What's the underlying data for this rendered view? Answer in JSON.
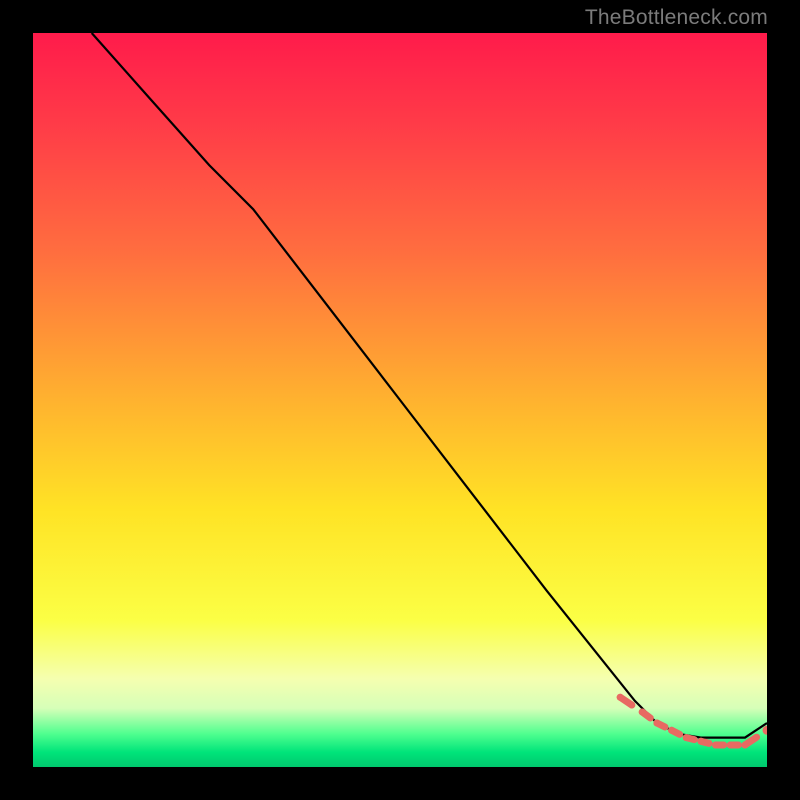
{
  "watermark": "TheBottleneck.com",
  "chart_data": {
    "type": "line",
    "title": "",
    "xlabel": "",
    "ylabel": "",
    "xlim": [
      0,
      100
    ],
    "ylim": [
      0,
      100
    ],
    "grid": false,
    "legend": false,
    "series": [
      {
        "name": "bottleneck-curve",
        "style": "solid-black",
        "x": [
          8,
          16,
          24,
          30,
          40,
          50,
          60,
          70,
          78,
          82,
          85,
          88,
          91,
          94,
          97,
          100
        ],
        "y": [
          100,
          91,
          82,
          76,
          63,
          50,
          37,
          24,
          14,
          9,
          6,
          4.5,
          4,
          4,
          4,
          6
        ]
      },
      {
        "name": "optimal-range-markers",
        "style": "dashed-coral-dots",
        "x": [
          80,
          83,
          85,
          87,
          89,
          91,
          93,
          95,
          97,
          100
        ],
        "y": [
          9.5,
          7.5,
          6,
          5,
          4,
          3.5,
          3,
          3,
          3,
          5
        ]
      }
    ],
    "gradient_stops": [
      {
        "offset": 0.0,
        "color": "#ff1b4b"
      },
      {
        "offset": 0.12,
        "color": "#ff3a48"
      },
      {
        "offset": 0.3,
        "color": "#ff6e3f"
      },
      {
        "offset": 0.5,
        "color": "#ffb22f"
      },
      {
        "offset": 0.65,
        "color": "#ffe325"
      },
      {
        "offset": 0.8,
        "color": "#fbff45"
      },
      {
        "offset": 0.88,
        "color": "#f5ffb0"
      },
      {
        "offset": 0.92,
        "color": "#d6ffb8"
      },
      {
        "offset": 0.955,
        "color": "#4fff8f"
      },
      {
        "offset": 0.98,
        "color": "#00e47a"
      },
      {
        "offset": 1.0,
        "color": "#00c86e"
      }
    ]
  }
}
